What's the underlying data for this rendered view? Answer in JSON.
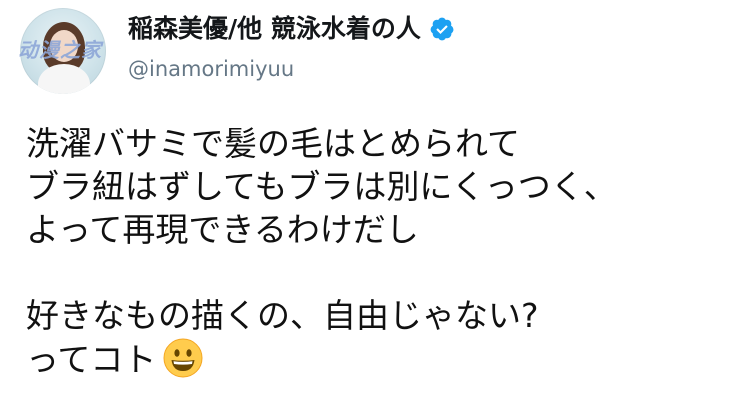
{
  "author": {
    "display_name": "稲森美優/他 競泳水着の人",
    "handle": "@inamorimiyuu",
    "verified_icon": "verified-badge-icon",
    "verified_color": "#1da1f2"
  },
  "watermark": {
    "text": "动漫之家"
  },
  "tweet": {
    "lines": [
      "洗濯バサミで髪の毛はとめられて",
      "ブラ紐はずしてもブラは別にくっつく、",
      "よって再現できるわけだし",
      "好きなもの描くの、自由じゃない?",
      "ってコト"
    ],
    "emoji_icon": "grinning-face-icon"
  }
}
